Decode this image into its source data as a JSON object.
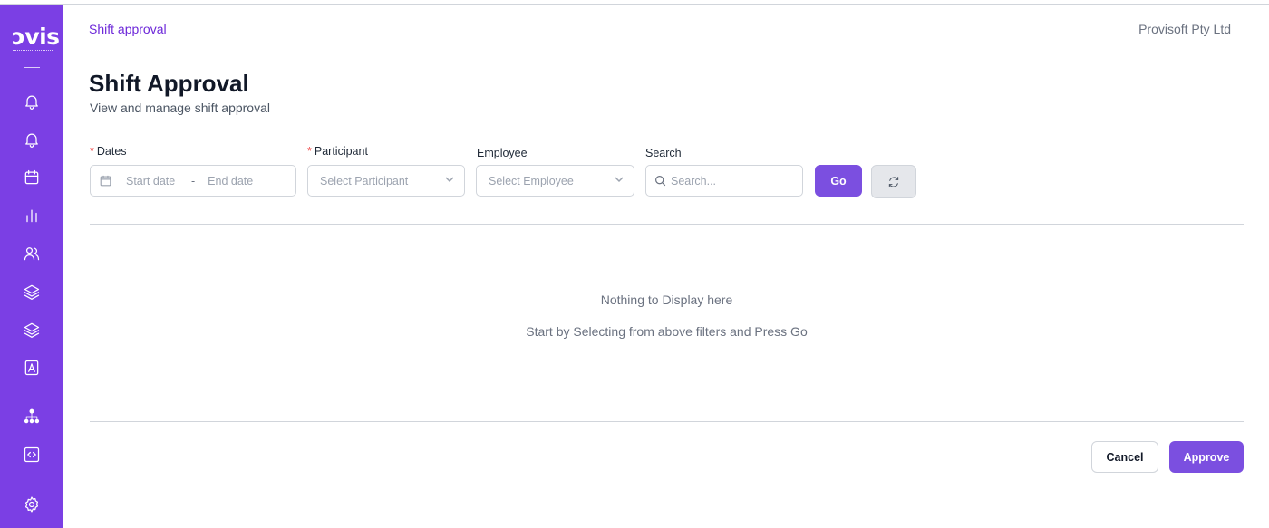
{
  "sidebar": {
    "logo_text": "ɔvis",
    "icons": [
      "menu-divider",
      "bell-icon",
      "bell-icon",
      "calendar-icon",
      "bar-chart-icon",
      "users-icon",
      "layers-icon",
      "layers-icon",
      "pdf-file-icon",
      "org-chart-icon",
      "code-icon",
      "settings-icon"
    ],
    "accent": "#7b3fe4"
  },
  "header": {
    "breadcrumb": "Shift approval",
    "company": "Provisoft Pty Ltd"
  },
  "page": {
    "title": "Shift Approval",
    "subtitle": "View and manage shift approval"
  },
  "filters": {
    "dates_label": "Dates",
    "start_placeholder": "Start date",
    "date_separator": "-",
    "end_placeholder": "End date",
    "participant_label": "Participant",
    "participant_placeholder": "Select Participant",
    "employee_label": "Employee",
    "employee_placeholder": "Select Employee",
    "search_label": "Search",
    "search_placeholder": "Search...",
    "required_marker": "*",
    "go_label": "Go"
  },
  "empty_state": {
    "line1": "Nothing to Display here",
    "line2": "Start by Selecting from above filters and Press Go"
  },
  "footer": {
    "cancel_label": "Cancel",
    "approve_label": "Approve"
  }
}
